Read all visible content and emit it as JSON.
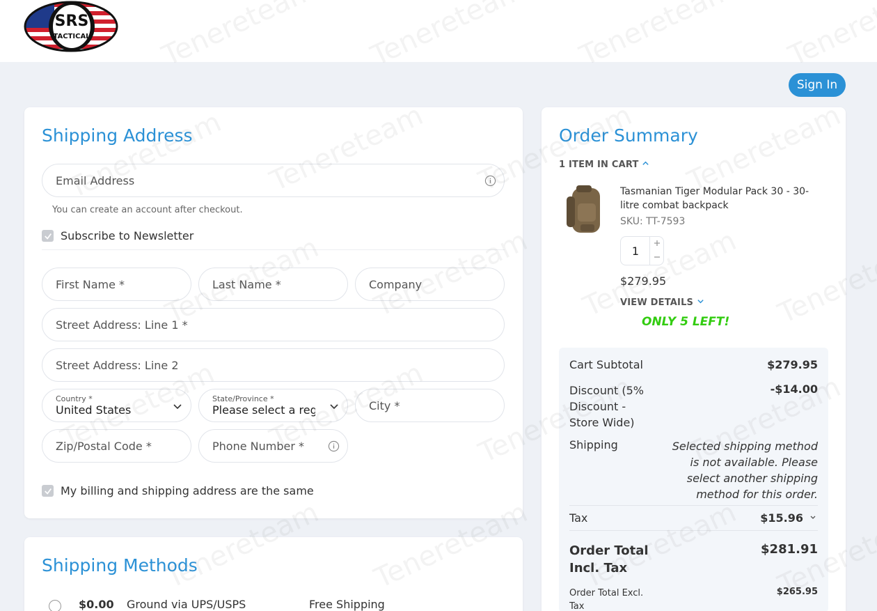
{
  "brand": {
    "logo_text_top": "SRS",
    "logo_text_bottom": "TACTICAL"
  },
  "header": {
    "sign_in_label": "Sign In"
  },
  "shipping_address": {
    "title": "Shipping Address",
    "email_placeholder": "Email Address",
    "email_hint": "You can create an account after checkout.",
    "newsletter_label": "Subscribe to Newsletter",
    "first_name_placeholder": "First Name *",
    "last_name_placeholder": "Last Name *",
    "company_placeholder": "Company",
    "street1_placeholder": "Street Address: Line 1 *",
    "street2_placeholder": "Street Address: Line 2",
    "country_label": "Country *",
    "country_value": "United States",
    "state_label": "State/Province *",
    "state_value": "Please select a region, state or province.",
    "city_placeholder": "City *",
    "zip_placeholder": "Zip/Postal Code *",
    "phone_placeholder": "Phone Number *",
    "billing_same_label": "My billing and shipping address are the same"
  },
  "shipping_methods": {
    "title": "Shipping Methods",
    "methods": [
      {
        "price": "$0.00",
        "carrier": "Ground via UPS/USPS",
        "name": "Free Shipping"
      }
    ]
  },
  "order_summary": {
    "title": "Order Summary",
    "items_in_cart": "1 ITEM IN CART",
    "item": {
      "name": "Tasmanian Tiger Modular Pack 30 - 30-litre combat backpack",
      "sku": "SKU: TT-7593",
      "qty": "1",
      "price": "$279.95",
      "view_details": "VIEW DETAILS",
      "stock_note": "ONLY 5 LEFT!"
    },
    "totals": {
      "subtotal_label": "Cart Subtotal",
      "subtotal_value": "$279.95",
      "discount_label": "Discount (5% Discount - Store Wide)",
      "discount_value": "-$14.00",
      "shipping_label": "Shipping",
      "shipping_value": "Selected shipping method is not available. Please select another shipping method for this order.",
      "tax_label": "Tax",
      "tax_value": "$15.96",
      "order_total_incl_label": "Order Total Incl. Tax",
      "order_total_incl_value": "$281.91",
      "order_total_excl_label": "Order Total Excl. Tax",
      "order_total_excl_value": "$265.95"
    }
  },
  "watermark": {
    "text": "Tenereteam"
  },
  "colors": {
    "accent": "#2b91d6",
    "stock_green": "#33cc11",
    "background": "#eef1f6"
  }
}
